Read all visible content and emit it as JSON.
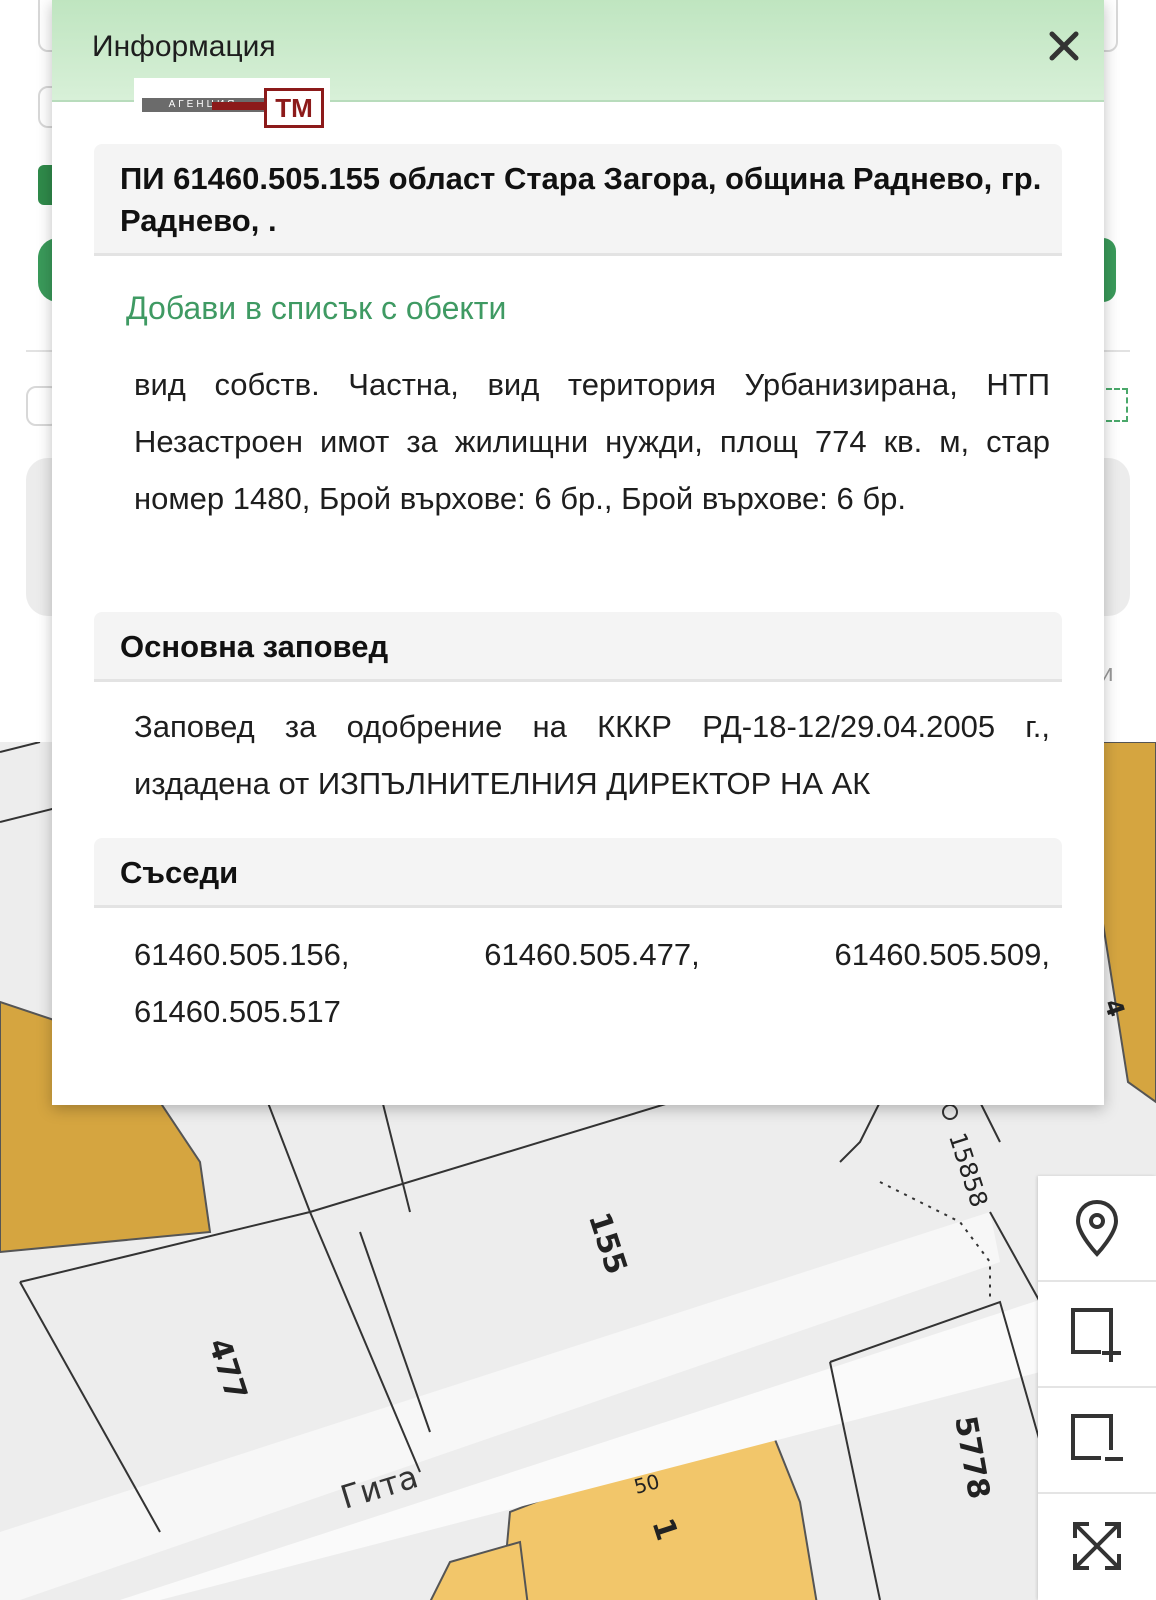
{
  "modal": {
    "title": "Информация",
    "logo_text": "АГЕНЦИЯ",
    "logo_mark": "TM",
    "property_heading": "ПИ 61460.505.155 област Стара Загора, община Раднево, гр. Раднево, .",
    "add_to_list_link": "Добави в списък с обекти",
    "details": "вид собств. Частна, вид територия Урбанизирана, НТП Незастроен имот за жилищни нужди, площ 774 кв. м, стар номер 1480, Брой върхове: 6 бр., Брой върхове: 6 бр.",
    "order_heading": "Основна заповед",
    "order_text": "Заповед за одобрение на КККР РД-18-12/29.04.2005 г., издадена от ИЗПЪЛНИТЕЛНИЯ ДИРЕКТОР НА АК",
    "neighbours_heading": "Съседи",
    "neighbours": [
      "61460.505.156,",
      "61460.505.477,",
      "61460.505.509,",
      "61460.505.517"
    ]
  },
  "map": {
    "parcel_labels": [
      "155",
      "477",
      "5778",
      "1",
      "50",
      "4"
    ],
    "point_label": "15858",
    "street_label": "Гита"
  },
  "toolbar": {
    "icons": [
      "map-pin-icon",
      "add-square-icon",
      "remove-square-icon",
      "expand-icon"
    ]
  },
  "background": {
    "partial_letter": "и"
  }
}
